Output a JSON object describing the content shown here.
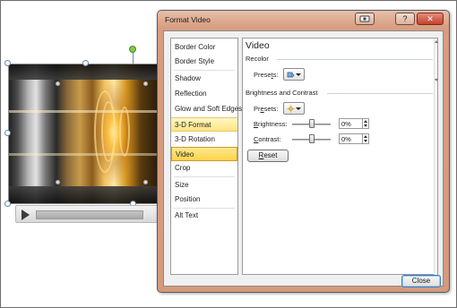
{
  "dialog": {
    "title": "Format Video",
    "titlebar_buttons": {
      "help": "?",
      "close": "✕"
    },
    "close_label": "Close"
  },
  "nav": {
    "items": [
      {
        "label": "Border Color"
      },
      {
        "label": "Border Style"
      },
      {
        "label": "Shadow"
      },
      {
        "label": "Reflection"
      },
      {
        "label": "Glow and Soft Edges"
      },
      {
        "label": "3-D Format"
      },
      {
        "label": "3-D Rotation"
      },
      {
        "label": "Video"
      },
      {
        "label": "Crop"
      },
      {
        "label": "Size"
      },
      {
        "label": "Position"
      },
      {
        "label": "Alt Text"
      }
    ],
    "selected": "Video",
    "highlighted": "3-D Format"
  },
  "panel": {
    "title": "Video",
    "recolor": {
      "heading": "Recolor",
      "presets_label_pre": "Prese",
      "presets_label_key": "t",
      "presets_label_post": "s:",
      "icon": "paint-bucket-icon"
    },
    "brightness_contrast": {
      "heading": "Brightness and Contrast",
      "presets_label_pre": "Pr",
      "presets_label_key": "e",
      "presets_label_post": "sets:",
      "icon": "sun-icon",
      "brightness_key": "B",
      "brightness_rest": "rightness:",
      "brightness_value": "0%",
      "contrast_key": "C",
      "contrast_rest": "ontrast:",
      "contrast_value": "0%"
    },
    "reset_key": "R",
    "reset_rest": "eset"
  },
  "colors": {
    "nav_selected": "#ffd34a",
    "nav_hover": "#ffe480",
    "titlebar": "#d79d80",
    "close_button": "#c5402b",
    "rotation_handle": "#7ccb49"
  }
}
